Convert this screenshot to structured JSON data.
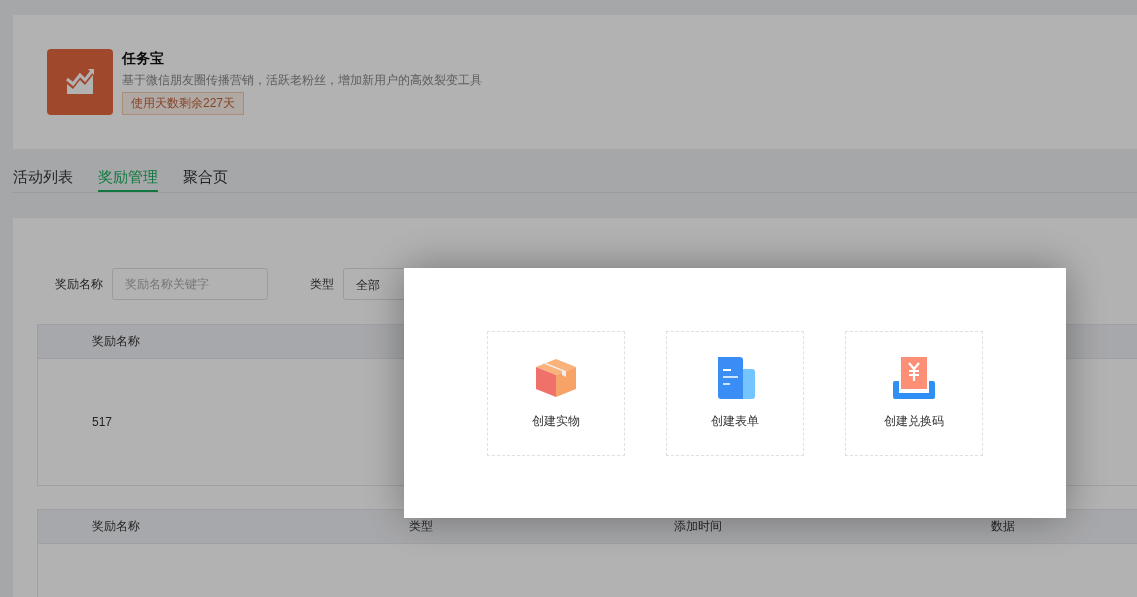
{
  "app": {
    "name": "任务宝",
    "description": "基于微信朋友圈传播营销，活跃老粉丝，增加新用户的高效裂变工具",
    "badge": "使用天数剩余227天"
  },
  "tabs": [
    {
      "label": "活动列表",
      "selected": false
    },
    {
      "label": "奖励管理",
      "selected": true
    },
    {
      "label": "聚合页",
      "selected": false
    }
  ],
  "filters": [
    {
      "kind": "input",
      "label": "奖励名称",
      "placeholder": "奖励名称关键字"
    },
    {
      "kind": "select",
      "label": "类型",
      "value": "全部"
    }
  ],
  "tables": [
    {
      "columns": [
        "奖励名称"
      ],
      "rows": [
        [
          "517"
        ]
      ]
    },
    {
      "columns": [
        "奖励名称",
        "类型",
        "添加时间",
        "数据"
      ]
    }
  ],
  "dialog": {
    "options": [
      {
        "kind": "goods",
        "label": "创建实物"
      },
      {
        "kind": "form",
        "label": "创建表单"
      },
      {
        "kind": "code",
        "label": "创建兑换码"
      }
    ]
  }
}
